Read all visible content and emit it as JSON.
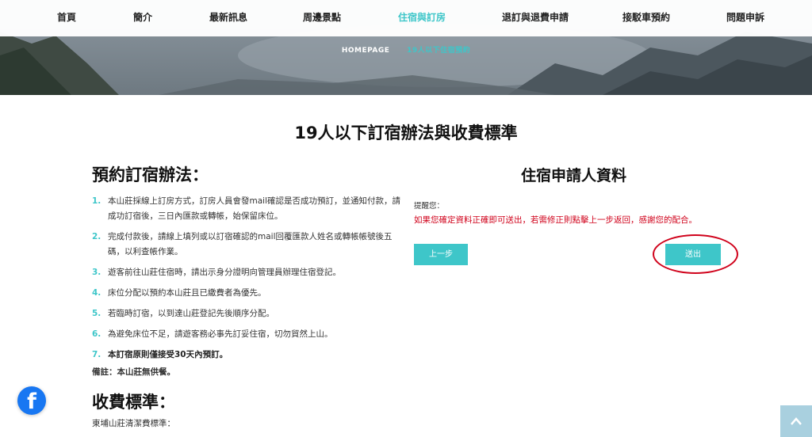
{
  "nav": {
    "items": [
      {
        "label": "首頁",
        "active": false
      },
      {
        "label": "簡介",
        "active": false
      },
      {
        "label": "最新訊息",
        "active": false
      },
      {
        "label": "周邊景點",
        "active": false
      },
      {
        "label": "住宿與訂房",
        "active": true
      },
      {
        "label": "退訂與退費申請",
        "active": false
      },
      {
        "label": "接駁車預約",
        "active": false
      },
      {
        "label": "問題申訴",
        "active": false
      }
    ]
  },
  "breadcrumb": {
    "home": "HOMEPAGE",
    "current": "19人以下住宿預約"
  },
  "page_title": "19人以下訂宿辦法與收費標準",
  "booking": {
    "heading": "預約訂宿辦法：",
    "rules": [
      {
        "num": "1.",
        "text": "本山莊採線上訂房方式，訂房人員會發mail確認是否成功預訂，並通知付款，請成功訂宿後，三日內匯款或轉帳，始保留床位。"
      },
      {
        "num": "2.",
        "text": "完成付款後，請線上填列或以訂宿確認的mail回覆匯款人姓名或轉帳帳號後五碼，以利查帳作業。"
      },
      {
        "num": "3.",
        "text": "遊客前往山莊住宿時，請出示身分證明向管理員辦理住宿登記。"
      },
      {
        "num": "4.",
        "text": "床位分配以預約本山莊且已繳費者為優先。"
      },
      {
        "num": "5.",
        "text": "若臨時訂宿，以到達山莊登記先後順序分配。"
      },
      {
        "num": "6.",
        "text": "為避免床位不足，請遊客務必事先訂妥住宿，切勿貿然上山。"
      },
      {
        "num": "7.",
        "text": "本訂宿原則僅接受30天內預訂。"
      }
    ],
    "note": "備註：本山莊無供餐。"
  },
  "fees": {
    "heading": "收費標準：",
    "subtitle": "東埔山莊清潔費標準："
  },
  "applicant": {
    "title": "住宿申請人資料",
    "reminder_label": "提醒您：",
    "reminder_msg": "如果您確定資料正確即可送出，若需修正則點擊上一步返回，感謝您的配合。",
    "prev_label": "上一步",
    "submit_label": "送出"
  },
  "colors": {
    "accent": "#3ec6c9",
    "warning": "#d0021b",
    "facebook": "#1877f2"
  },
  "icons": {
    "facebook": "facebook-icon",
    "back_to_top": "chevron-up-icon"
  }
}
